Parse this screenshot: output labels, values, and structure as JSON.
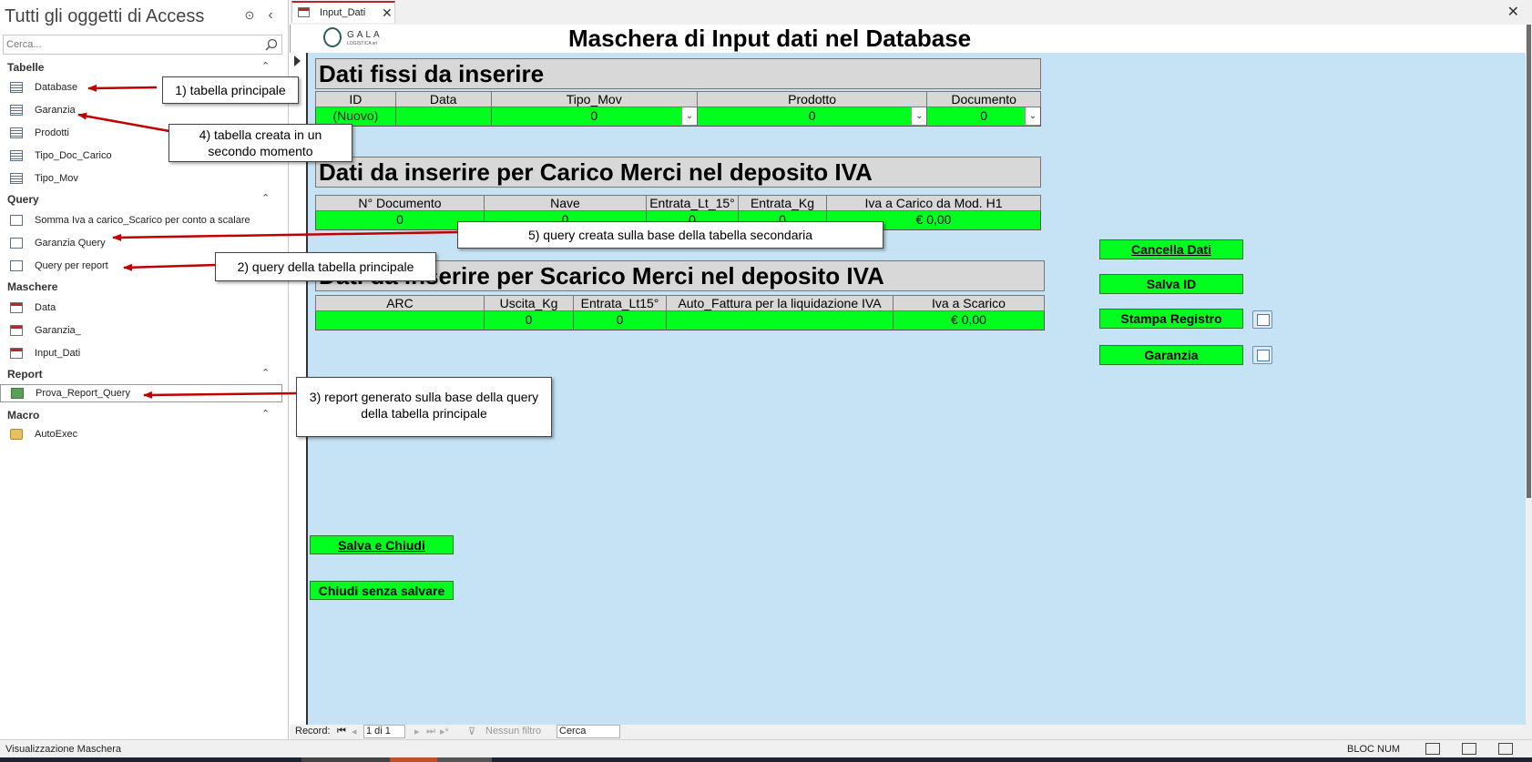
{
  "nav": {
    "title": "Tutti gli oggetti di Access",
    "search_placeholder": "Cerca...",
    "sections": {
      "tabelle": {
        "label": "Tabelle",
        "items": [
          "Database",
          "Garanzia",
          "Prodotti",
          "Tipo_Doc_Carico",
          "Tipo_Mov"
        ]
      },
      "query": {
        "label": "Query",
        "items": [
          "Somma Iva a carico_Scarico per conto a scalare",
          "Garanzia Query",
          "Query per report"
        ]
      },
      "maschere": {
        "label": "Maschere",
        "items": [
          "Data",
          "Garanzia_",
          "Input_Dati"
        ]
      },
      "report": {
        "label": "Report",
        "items": [
          "Prova_Report_Query"
        ]
      },
      "macro": {
        "label": "Macro",
        "items": [
          "AutoExec"
        ]
      }
    }
  },
  "tab": {
    "label": "Input_Dati"
  },
  "form": {
    "logo_text": "GALA",
    "logo_subtext": "LOGISTICA srl",
    "title": "Maschera di Input dati nel Database",
    "section1": {
      "title": "Dati fissi da inserire",
      "headers": [
        "ID",
        "Data",
        "Tipo_Mov",
        "Prodotto",
        "Documento"
      ],
      "values": [
        "(Nuovo)",
        "",
        "0",
        "0",
        "0"
      ]
    },
    "section2": {
      "title": "Dati da inserire per Carico Merci nel deposito IVA",
      "headers": [
        "N° Documento",
        "Nave",
        "Entrata_Lt_15°",
        "Entrata_Kg",
        "Iva a Carico da Mod. H1"
      ],
      "values": [
        "0",
        "0",
        "0",
        "0",
        "€ 0,00"
      ]
    },
    "section3": {
      "title": "Dati da inserire per Scarico Merci nel deposito IVA",
      "headers": [
        "ARC",
        "Uscita_Kg",
        "Entrata_Lt15°",
        "Auto_Fattura per la liquidazione IVA",
        "Iva a Scarico"
      ],
      "values": [
        "",
        "0",
        "0",
        "",
        "€ 0,00"
      ]
    },
    "buttons": {
      "cancella": "Cancella Dati",
      "salva_id": "Salva ID",
      "stampa": "Stampa Registro",
      "garanzia": "Garanzia",
      "salva_chiudi": "Salva e Chiudi",
      "chiudi": "Chiudi senza salvare"
    }
  },
  "record_nav": {
    "label": "Record:",
    "position": "1 di 1",
    "filter": "Nessun filtro",
    "search": "Cerca"
  },
  "status": {
    "left": "Visualizzazione Maschera",
    "right": "BLOC NUM"
  },
  "callouts": {
    "c1": "1) tabella principale",
    "c2": "2) query della tabella principale",
    "c3_line1": "3) report generato sulla base della query",
    "c3_line2": "della tabella principale",
    "c4_line1": "4) tabella creata in un",
    "c4_line2": "secondo momento",
    "c5": "5) query creata sulla base della tabella secondaria"
  },
  "colors": {
    "field_green": "#00ff1e",
    "form_bg": "#c5e3f5",
    "arrow_red": "#c00000",
    "tab_accent": "#b5282b"
  }
}
